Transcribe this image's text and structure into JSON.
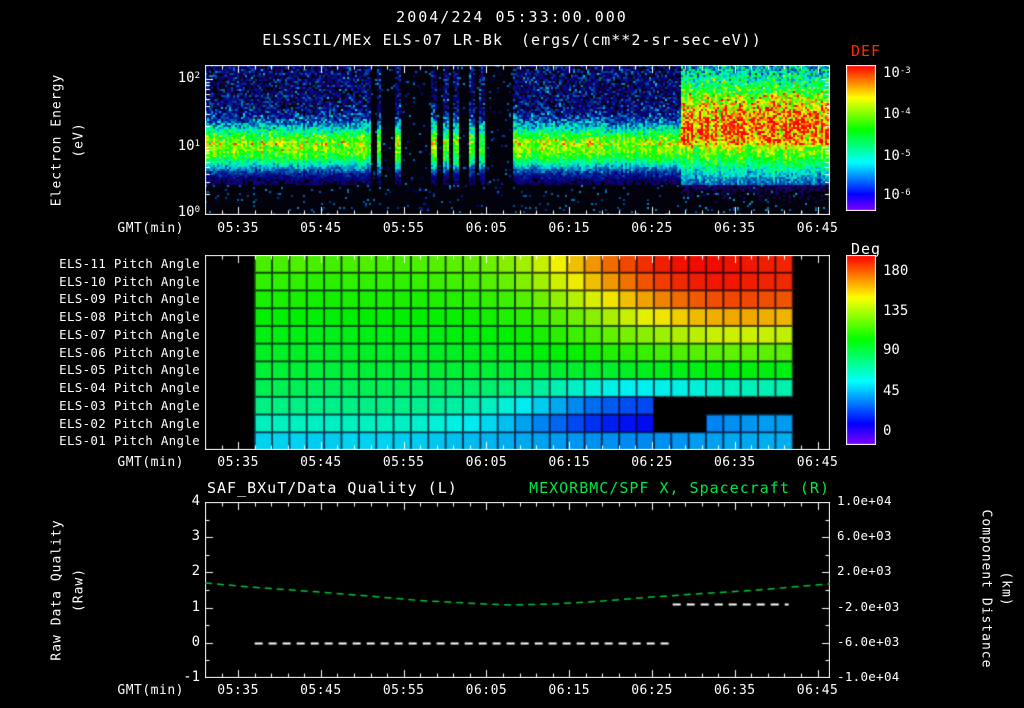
{
  "colors": {
    "background": "#000000",
    "text": "#ffffff",
    "frame": "#ffffff",
    "accent_green": "#00e645",
    "series_green": "#00c838",
    "series_white": "#ffffff",
    "def_title": "#ff2b00",
    "no_data": "#000000"
  },
  "header": {
    "datetime": "2004/224 05:33:00.000",
    "instrument": "ELSSCIL/MEx ELS-07 LR-Bk",
    "units": "(ergs/(cm**2-sr-sec-eV))"
  },
  "time_axis": {
    "label": "GMT(min)",
    "start_min": 331,
    "end_min": 406.5,
    "ticks": [
      "05:35",
      "05:45",
      "05:55",
      "06:05",
      "06:15",
      "06:25",
      "06:35",
      "06:45"
    ],
    "minor_tick_step_min": 2
  },
  "chart_data": [
    {
      "type": "heatmap",
      "name": "electron-energy-spectrogram",
      "ylabel_lines": [
        "Electron Energy",
        "(eV)"
      ],
      "y_scale": "log",
      "y_range_ev": [
        1,
        158
      ],
      "y_log_max": 2.2,
      "y_ticks": [
        {
          "label": "10^2",
          "frac": 0.091
        },
        {
          "label": "10^1",
          "frac": 0.545
        },
        {
          "label": "10^0",
          "frac": 0.985
        }
      ],
      "colorbar": {
        "title": "DEF",
        "units": "ergs/(cm**2-sr-sec-eV)",
        "range_log10_flux": [
          -6,
          -3
        ],
        "ticks": [
          {
            "label": "10^-3",
            "frac": 0.06
          },
          {
            "label": "10^-4",
            "frac": 0.345
          },
          {
            "label": "10^-5",
            "frac": 0.63
          },
          {
            "label": "10^-6",
            "frac": 0.9
          }
        ]
      },
      "features": {
        "main_band": {
          "center_log_ev": 1.0,
          "sigma_log": 0.22,
          "amplitude": 0.62
        },
        "enhanced_band": {
          "center_log_ev": 1.3,
          "sigma_log": 0.5,
          "amplitude": 0.78
        },
        "enhanced_after_min": 388.5,
        "dropout_min": [
          351,
          368
        ],
        "burst_columns_min": [
          351.9,
          354.2,
          358.5,
          359.9,
          361.3,
          363.1,
          364.3
        ],
        "speckle_amp": 0.22,
        "speckle_amp_enhanced": 0.34,
        "noise": 0.12
      }
    },
    {
      "type": "heatmap",
      "name": "pitch-angle-panel",
      "rows": [
        "ELS-11 Pitch Angle",
        "ELS-10 Pitch Angle",
        "ELS-09 Pitch Angle",
        "ELS-08 Pitch Angle",
        "ELS-07 Pitch Angle",
        "ELS-06 Pitch Angle",
        "ELS-05 Pitch Angle",
        "ELS-04 Pitch Angle",
        "ELS-03 Pitch Angle",
        "ELS-02 Pitch Angle",
        "ELS-01 Pitch Angle"
      ],
      "data_start_min": 337,
      "data_end_min": 402,
      "no_data_value": -1,
      "colorbar": {
        "title": "Deg",
        "range": [
          0,
          180
        ],
        "ticks": [
          {
            "label": 180,
            "frac": 0.09
          },
          {
            "label": 135,
            "frac": 0.3
          },
          {
            "label": 90,
            "frac": 0.505
          },
          {
            "label": 45,
            "frac": 0.72
          },
          {
            "label": 0,
            "frac": 0.93
          }
        ]
      },
      "values": [
        [
          112,
          112,
          113,
          112,
          111,
          112,
          113,
          112,
          112,
          113,
          114,
          115,
          116,
          118,
          122,
          127,
          133,
          140,
          148,
          155,
          162,
          168,
          172,
          175,
          177,
          178,
          178,
          177,
          176,
          175,
          174
        ],
        [
          108,
          108,
          108,
          107,
          107,
          108,
          108,
          108,
          108,
          109,
          110,
          111,
          112,
          114,
          117,
          121,
          127,
          134,
          141,
          148,
          155,
          161,
          166,
          170,
          173,
          175,
          176,
          176,
          175,
          174,
          173
        ],
        [
          104,
          104,
          104,
          103,
          103,
          104,
          104,
          104,
          104,
          104,
          105,
          106,
          107,
          108,
          110,
          114,
          118,
          124,
          130,
          136,
          142,
          148,
          153,
          158,
          162,
          165,
          167,
          168,
          168,
          167,
          166
        ],
        [
          100,
          100,
          100,
          99,
          99,
          100,
          100,
          100,
          100,
          100,
          101,
          101,
          102,
          103,
          105,
          107,
          110,
          114,
          118,
          123,
          128,
          133,
          138,
          142,
          146,
          149,
          151,
          152,
          152,
          151,
          150
        ],
        [
          97,
          97,
          97,
          96,
          96,
          97,
          97,
          97,
          97,
          97,
          97,
          98,
          98,
          99,
          100,
          102,
          104,
          107,
          110,
          113,
          116,
          120,
          123,
          126,
          129,
          131,
          133,
          134,
          134,
          133,
          132
        ],
        [
          94,
          94,
          94,
          93,
          93,
          94,
          94,
          94,
          94,
          94,
          94,
          94,
          95,
          95,
          96,
          97,
          98,
          100,
          101,
          103,
          105,
          107,
          109,
          111,
          113,
          114,
          115,
          116,
          116,
          115,
          115
        ],
        [
          91,
          91,
          91,
          90,
          90,
          91,
          91,
          91,
          91,
          91,
          91,
          91,
          91,
          91,
          91,
          91,
          92,
          92,
          92,
          93,
          93,
          94,
          95,
          96,
          96,
          97,
          98,
          98,
          98,
          98,
          97
        ],
        [
          86,
          86,
          86,
          85,
          85,
          86,
          86,
          86,
          86,
          85,
          85,
          84,
          83,
          82,
          80,
          77,
          74,
          70,
          67,
          64,
          62,
          60,
          60,
          61,
          62,
          64,
          66,
          68,
          69,
          70,
          71
        ],
        [
          78,
          78,
          78,
          77,
          77,
          78,
          78,
          78,
          77,
          76,
          75,
          73,
          71,
          68,
          64,
          59,
          54,
          48,
          43,
          38,
          35,
          33,
          32,
          -1,
          -1,
          -1,
          -1,
          -1,
          -1,
          -1,
          -1
        ],
        [
          68,
          68,
          68,
          67,
          67,
          68,
          68,
          68,
          67,
          66,
          64,
          62,
          59,
          56,
          52,
          47,
          42,
          37,
          32,
          28,
          25,
          23,
          22,
          -1,
          -1,
          -1,
          42,
          44,
          45,
          46,
          46
        ],
        [
          55,
          55,
          55,
          54,
          54,
          55,
          55,
          55,
          54,
          54,
          53,
          52,
          51,
          50,
          49,
          48,
          47,
          46,
          45,
          44,
          44,
          43,
          43,
          44,
          45,
          46,
          47,
          48,
          48,
          49,
          49
        ]
      ]
    },
    {
      "type": "line",
      "title_left": "SAF_BXuT/Data Quality (L)",
      "title_right": "MEXORBMC/SPF X, Spacecraft (R)",
      "left_axis": {
        "label_lines": [
          "Raw Data Quality",
          "(Raw)"
        ],
        "range": [
          -1,
          4
        ],
        "ticks": [
          4,
          3,
          2,
          1,
          0,
          -1
        ]
      },
      "right_axis": {
        "label_lines": [
          "Component Distance",
          "(km)"
        ],
        "range": [
          -10000,
          10000
        ],
        "ticks": [
          "1.0e+04",
          "6.0e+03",
          "2.0e+03",
          "-2.0e+03",
          "-6.0e+03",
          "-1.0e+04"
        ],
        "tick_values": [
          10000,
          6000,
          2000,
          -2000,
          -6000,
          -10000
        ]
      },
      "series": [
        {
          "name": "MEXORBMC/SPF X, Spacecraft",
          "axis": "right",
          "style": "dashed",
          "color_key": "series_green",
          "points_min_km": [
            [
              331,
              800
            ],
            [
              337,
              300
            ],
            [
              345,
              -250
            ],
            [
              351,
              -700
            ],
            [
              357,
              -1200
            ],
            [
              363,
              -1500
            ],
            [
              368,
              -1700
            ],
            [
              373,
              -1600
            ],
            [
              379,
              -1250
            ],
            [
              385,
              -800
            ],
            [
              391,
              -400
            ],
            [
              397,
              -60
            ],
            [
              403,
              420
            ],
            [
              406.5,
              700
            ]
          ]
        },
        {
          "name": "SAF_BXuT/Data Quality",
          "axis": "left",
          "style": "dashed",
          "color_key": "series_white",
          "segments": [
            {
              "t": [
                337,
                387
              ],
              "value": 0
            },
            {
              "t": [
                387.5,
                401.5
              ],
              "value": 1.1
            }
          ]
        }
      ]
    }
  ]
}
